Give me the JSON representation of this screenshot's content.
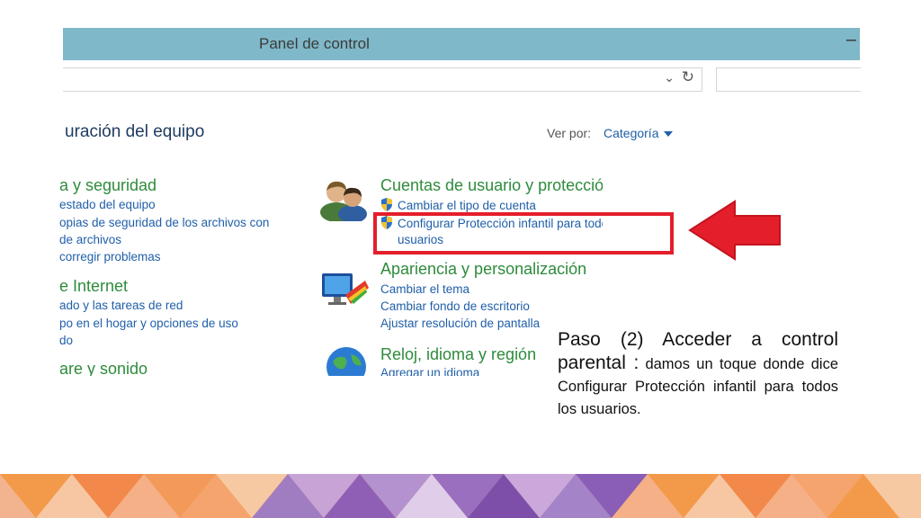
{
  "window": {
    "title": "Panel de control",
    "minimize_glyph": "–"
  },
  "address_bar": {
    "dropdown_glyph": "⌄",
    "refresh_glyph": "↻"
  },
  "page": {
    "heading": "uración del equipo",
    "view_by_label": "Ver por:",
    "view_by_value": "Categoría"
  },
  "left_column": {
    "categories": [
      {
        "title": "a y seguridad",
        "links": [
          "estado del equipo",
          "opias de seguridad de los archivos con",
          "de archivos",
          "corregir problemas"
        ]
      },
      {
        "title": "e Internet",
        "links": [
          "ado y las tareas de red",
          "po en el hogar y opciones de uso",
          "do"
        ]
      },
      {
        "title": "are y sonido",
        "links": []
      }
    ]
  },
  "right_column": {
    "accounts": {
      "title": "Cuentas de usuario y protección infantil",
      "link_change_account": "Cambiar el tipo de cuenta",
      "link_parental_line1": "Configurar Protección infantil para todos los",
      "link_parental_line2": "usuarios",
      "icon": "users-icon"
    },
    "appearance": {
      "title": "Apariencia y personalización",
      "links": [
        "Cambiar el tema",
        "Cambiar fondo de escritorio",
        "Ajustar resolución de pantalla"
      ],
      "icon": "monitor-paint-icon"
    },
    "clock": {
      "title": "Reloj, idioma y región",
      "links": [
        "Agregar un idioma"
      ],
      "icon": "globe-clock-icon"
    }
  },
  "annotation": {
    "step_bold": "Paso (2) Acceder a control parental :",
    "step_text": "damos un toque donde dice Configurar Protección infantil para todos los usuarios.",
    "highlight_color": "#e41e2b"
  },
  "colors": {
    "titlebar": "#7fb8c8",
    "link": "#1f5fa8",
    "category": "#2e8b3c"
  }
}
